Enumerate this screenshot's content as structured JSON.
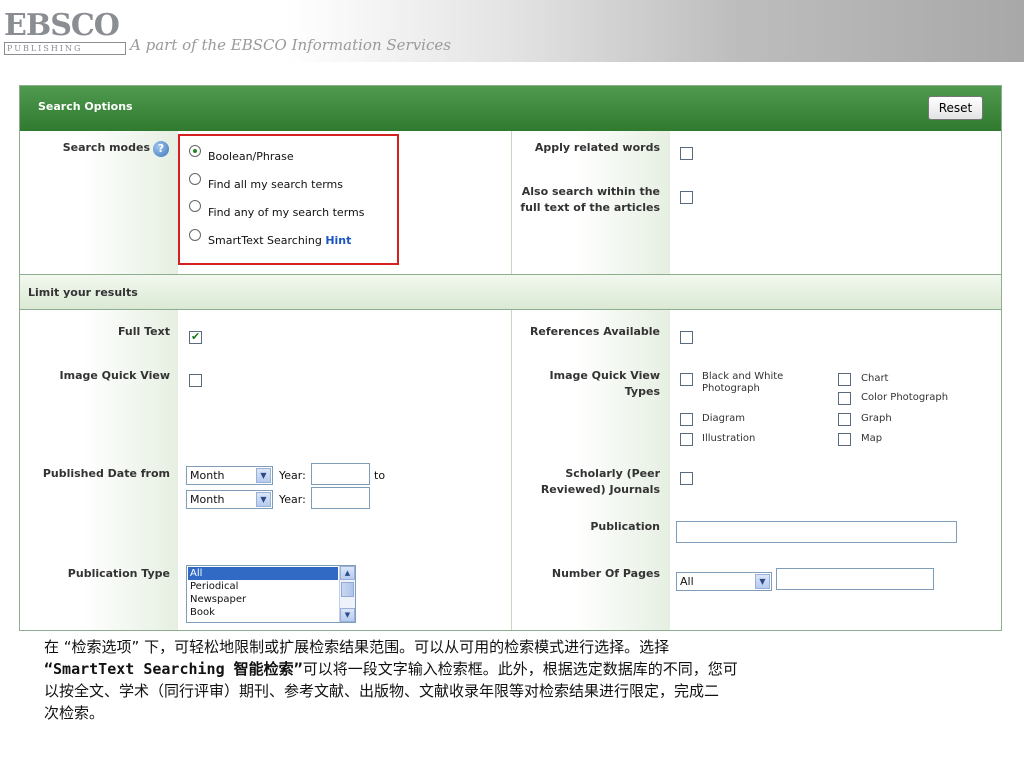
{
  "header": {
    "logo_top": "EBSCO",
    "logo_bottom": "PUBLISHING",
    "tagline": "A part of the EBSCO Information Services"
  },
  "search_options": {
    "title": "Search Options",
    "reset_label": "Reset",
    "search_modes_label": "Search modes",
    "modes": [
      {
        "label": "Boolean/Phrase",
        "selected": true
      },
      {
        "label": "Find all my search terms",
        "selected": false
      },
      {
        "label": "Find any of my search terms",
        "selected": false
      },
      {
        "label": "SmartText Searching",
        "selected": false
      }
    ],
    "hint_label": "Hint",
    "apply_related_words_label": "Apply related words",
    "full_text_search_label": "Also search within the full text of the articles"
  },
  "limits": {
    "title": "Limit your results",
    "full_text_label": "Full Text",
    "full_text_checked": true,
    "references_label": "References Available",
    "image_quick_view_label": "Image Quick View",
    "image_quick_view_types_label": "Image Quick View Types",
    "image_types": {
      "bw_photo": "Black and White Photograph",
      "chart": "Chart",
      "color_photo": "Color Photograph",
      "diagram": "Diagram",
      "graph": "Graph",
      "illustration": "Illustration",
      "map": "Map"
    },
    "published_date_label": "Published Date from",
    "month_value": "Month",
    "year_label": "Year:",
    "to_label": "to",
    "scholarly_label": "Scholarly (Peer Reviewed) Journals",
    "publication_label": "Publication",
    "publication_type_label": "Publication Type",
    "publication_types": [
      "All",
      "Periodical",
      "Newspaper",
      "Book"
    ],
    "number_of_pages_label": "Number Of Pages",
    "pages_value": "All"
  },
  "caption": {
    "line1": "在 “检索选项” 下，可轻松地限制或扩展检索结果范围。可以从可用的检索模式进行选择。选择",
    "line2_bold": "“SmartText Searching 智能检索”",
    "line2_rest": "可以将一段文字输入检索框。此外，根据选定数据库的不同，您可",
    "line3": "以按全文、学术（同行评审）期刊、参考文献、出版物、文献收录年限等对检索结果进行限定，完成二",
    "line4": "次检索。"
  }
}
